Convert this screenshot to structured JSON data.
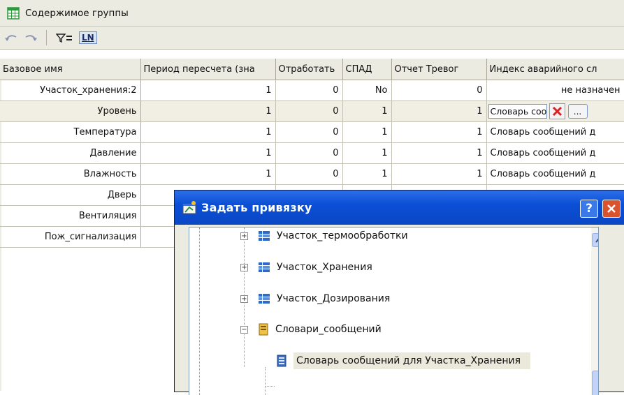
{
  "panel": {
    "title": "Содержимое группы",
    "toolbar": {
      "ln_label": "LN"
    }
  },
  "table": {
    "columns": [
      "Базовое имя",
      "Период пересчета (зна",
      "Отработать",
      "СПАД",
      "Отчет Тревог",
      "Индекс аварийного сл"
    ],
    "rows": [
      {
        "name": "Участок_хранения:2",
        "period": "1",
        "process": "0",
        "spad": "No",
        "report": "0",
        "index": "не назначен"
      },
      {
        "name": "Уровень",
        "period": "1",
        "process": "0",
        "spad": "1",
        "report": "1",
        "index": "Словарь сооб"
      },
      {
        "name": "Температура",
        "period": "1",
        "process": "0",
        "spad": "1",
        "report": "1",
        "index": "Словарь сообщений д"
      },
      {
        "name": "Давление",
        "period": "1",
        "process": "0",
        "spad": "1",
        "report": "1",
        "index": "Словарь сообщений д"
      },
      {
        "name": "Влажность",
        "period": "1",
        "process": "0",
        "spad": "1",
        "report": "1",
        "index": "Словарь сообщений д"
      },
      {
        "name": "Дверь"
      },
      {
        "name": "Вентиляция"
      },
      {
        "name": "Пож_сигнализация"
      }
    ],
    "edit_button_label": "..."
  },
  "dialog": {
    "title": "Задать привязку",
    "help_label": "?",
    "tree": [
      {
        "label": "Участок_термообработки",
        "expander": "+"
      },
      {
        "label": "Участок_Хранения",
        "expander": "+"
      },
      {
        "label": "Участок_Дозирования",
        "expander": "+"
      },
      {
        "label": "Словари_сообщений",
        "expander": "−"
      },
      {
        "label": "Словарь сообщений для Участка_Хранения"
      }
    ]
  },
  "colors": {
    "panel_bg": "#ecebe2",
    "dialog_title": "#0b4fd6",
    "close_button": "#d9532d",
    "selected_row": "#f1efe4"
  }
}
